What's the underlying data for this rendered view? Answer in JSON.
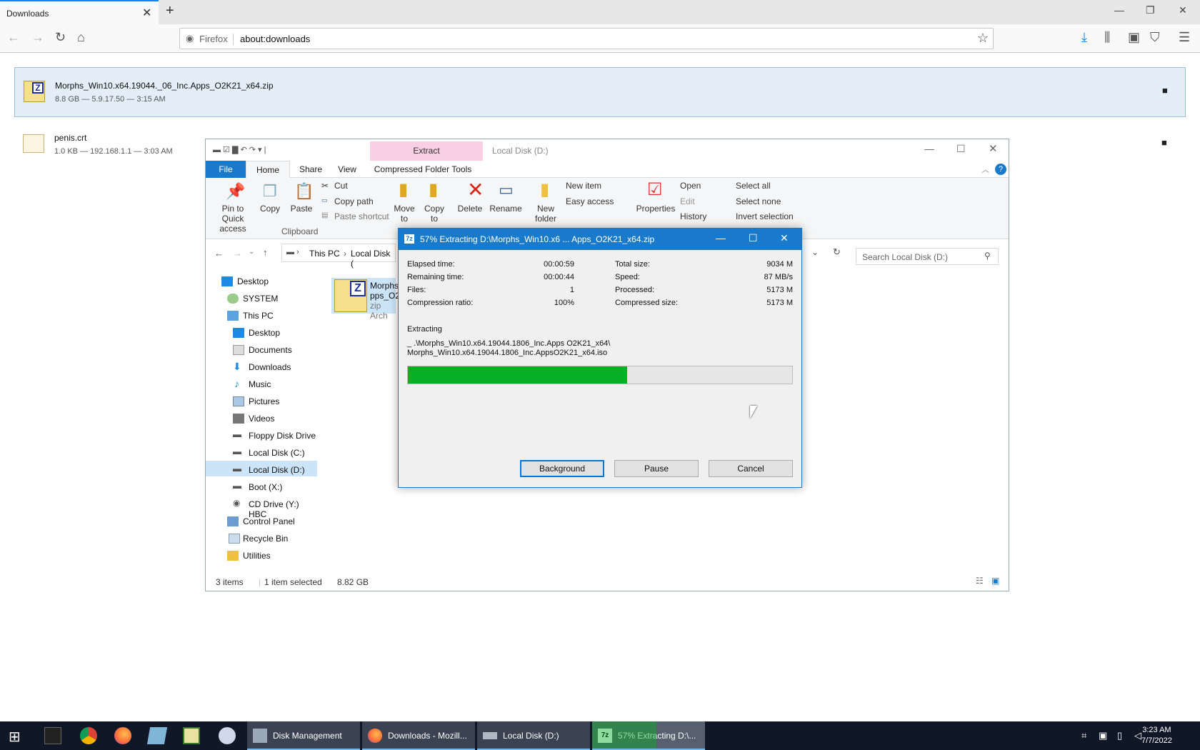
{
  "browser": {
    "tab_title": "Downloads",
    "identity_label": "Firefox",
    "url": "about:downloads"
  },
  "downloads": [
    {
      "name": "Morphs_Win10.x64.19044._06_Inc.Apps_O2K21_x64.zip",
      "meta": "8.8 GB — 5.9.17.50 — 3:15 AM"
    },
    {
      "name": "penis.crt",
      "meta": "1.0 KB — 192.168.1.1 — 3:03 AM"
    }
  ],
  "explorer": {
    "context_tab": "Extract",
    "window_title": "Local Disk (D:)",
    "tabs": [
      "File",
      "Home",
      "Share",
      "View",
      "Compressed Folder Tools"
    ],
    "ribbon": {
      "pin": "Pin to Quick access",
      "copy": "Copy",
      "paste": "Paste",
      "cut": "Cut",
      "copy_path": "Copy path",
      "paste_shortcut": "Paste shortcut",
      "clipboard": "Clipboard",
      "move_to": "Move to",
      "copy_to": "Copy to",
      "delete": "Delete",
      "rename": "Rename",
      "new_folder": "New folder",
      "new_item": "New item",
      "easy_access": "Easy access",
      "properties": "Properties",
      "open": "Open",
      "edit": "Edit",
      "history": "History",
      "select_all": "Select all",
      "select_none": "Select none",
      "invert_selection": "Invert selection"
    },
    "breadcrumb": [
      "This PC",
      "Local Disk ("
    ],
    "search_placeholder": "Search Local Disk (D:)",
    "tree": [
      "Desktop",
      "SYSTEM",
      "This PC",
      "Desktop",
      "Documents",
      "Downloads",
      "Music",
      "Pictures",
      "Videos",
      "Floppy Disk Drive",
      "Local Disk (C:)",
      "Local Disk (D:)",
      "Boot (X:)",
      "CD Drive (Y:) HBC",
      "Control Panel",
      "Recycle Bin",
      "Utilities"
    ],
    "file_item": {
      "name_line1": "Morphs",
      "name_line2": "pps_O2",
      "type": "zip Arch"
    },
    "status_items": "3 items",
    "status_selected": "1 item selected",
    "status_size": "8.82 GB"
  },
  "dialog": {
    "title": "57% Extracting D:\\Morphs_Win10.x6 ... Apps_O2K21_x64.zip",
    "left_stats": [
      {
        "label": "Elapsed time:",
        "value": "00:00:59"
      },
      {
        "label": "Remaining time:",
        "value": "00:00:44"
      },
      {
        "label": "Files:",
        "value": "1"
      },
      {
        "label": "Compression ratio:",
        "value": "100%"
      }
    ],
    "right_stats": [
      {
        "label": "Total size:",
        "value": "9034 M"
      },
      {
        "label": "Speed:",
        "value": "87 MB/s"
      },
      {
        "label": "Processed:",
        "value": "5173 M"
      },
      {
        "label": "Compressed size:",
        "value": "5173 M"
      }
    ],
    "extracting_label": "Extracting",
    "path_line1": "_ .\\Morphs_Win10.x64.19044.1806_Inc.Apps O2K21_x64\\",
    "path_line2": "Morphs_Win10.x64.19044.1806_Inc.AppsO2K21_x64.iso",
    "progress": 0.57,
    "buttons": {
      "background": "Background",
      "pause": "Pause",
      "cancel": "Cancel"
    }
  },
  "taskbar": {
    "tasks": [
      "Disk Management",
      "Downloads - Mozill...",
      "Local Disk (D:)",
      "57% Extracting D:\\..."
    ],
    "time": "3:23 AM",
    "date": "7/7/2022"
  }
}
